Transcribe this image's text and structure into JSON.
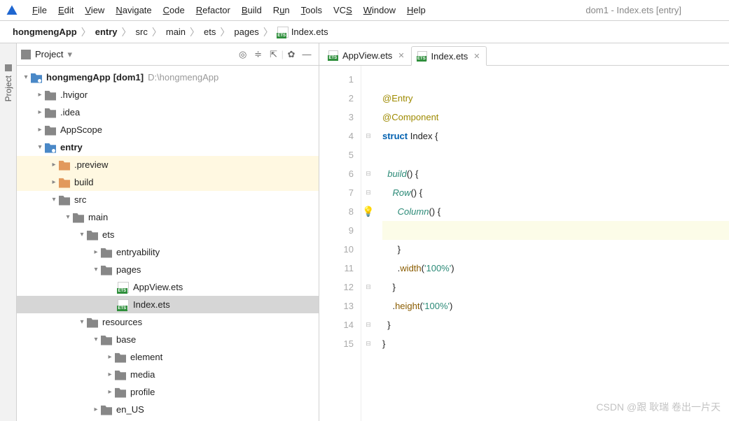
{
  "window_title": "dom1 - Index.ets [entry]",
  "menu": [
    "File",
    "Edit",
    "View",
    "Navigate",
    "Code",
    "Refactor",
    "Build",
    "Run",
    "Tools",
    "VCS",
    "Window",
    "Help"
  ],
  "breadcrumb": [
    "hongmengApp",
    "entry",
    "src",
    "main",
    "ets",
    "pages",
    "Index.ets"
  ],
  "project_label": "Project",
  "tree": {
    "root": "hongmengApp",
    "root_tag": "[dom1]",
    "root_path": "D:\\hongmengApp",
    "n1": ".hvigor",
    "n2": ".idea",
    "n3": "AppScope",
    "n4": "entry",
    "n4a": ".preview",
    "n4b": "build",
    "n4c": "src",
    "n4c1": "main",
    "n4c1a": "ets",
    "n4c1a1": "entryability",
    "n4c1a2": "pages",
    "n4c1a2a": "AppView.ets",
    "n4c1a2b": "Index.ets",
    "n4c1b": "resources",
    "n4c1b1": "base",
    "n4c1b1a": "element",
    "n4c1b1b": "media",
    "n4c1b1c": "profile",
    "n4c1b2": "en_US"
  },
  "tabs": [
    {
      "label": "AppView.ets"
    },
    {
      "label": "Index.ets"
    }
  ],
  "code": {
    "l1": "",
    "l2a": "@Entry",
    "l3a": "@Component",
    "l4a": "struct",
    "l4b": " Index {",
    "l5": "",
    "l6a": "  build",
    "l6b": "() {",
    "l7a": "    Row",
    "l7b": "() {",
    "l8a": "      Column",
    "l8b": "() {",
    "l9": "",
    "l10": "      }",
    "l11a": "      .",
    "l11b": "width",
    "l11c": "(",
    "l11d": "'100%'",
    "l11e": ")",
    "l12": "    }",
    "l13a": "    .",
    "l13b": "height",
    "l13c": "(",
    "l13d": "'100%'",
    "l13e": ")",
    "l14": "  }",
    "l15": "}"
  },
  "gutter": [
    "1",
    "2",
    "3",
    "4",
    "5",
    "6",
    "7",
    "8",
    "9",
    "10",
    "11",
    "12",
    "13",
    "14",
    "15"
  ],
  "side_label": "Project",
  "watermark": "CSDN @跟 耿瑞 卷出一片天"
}
